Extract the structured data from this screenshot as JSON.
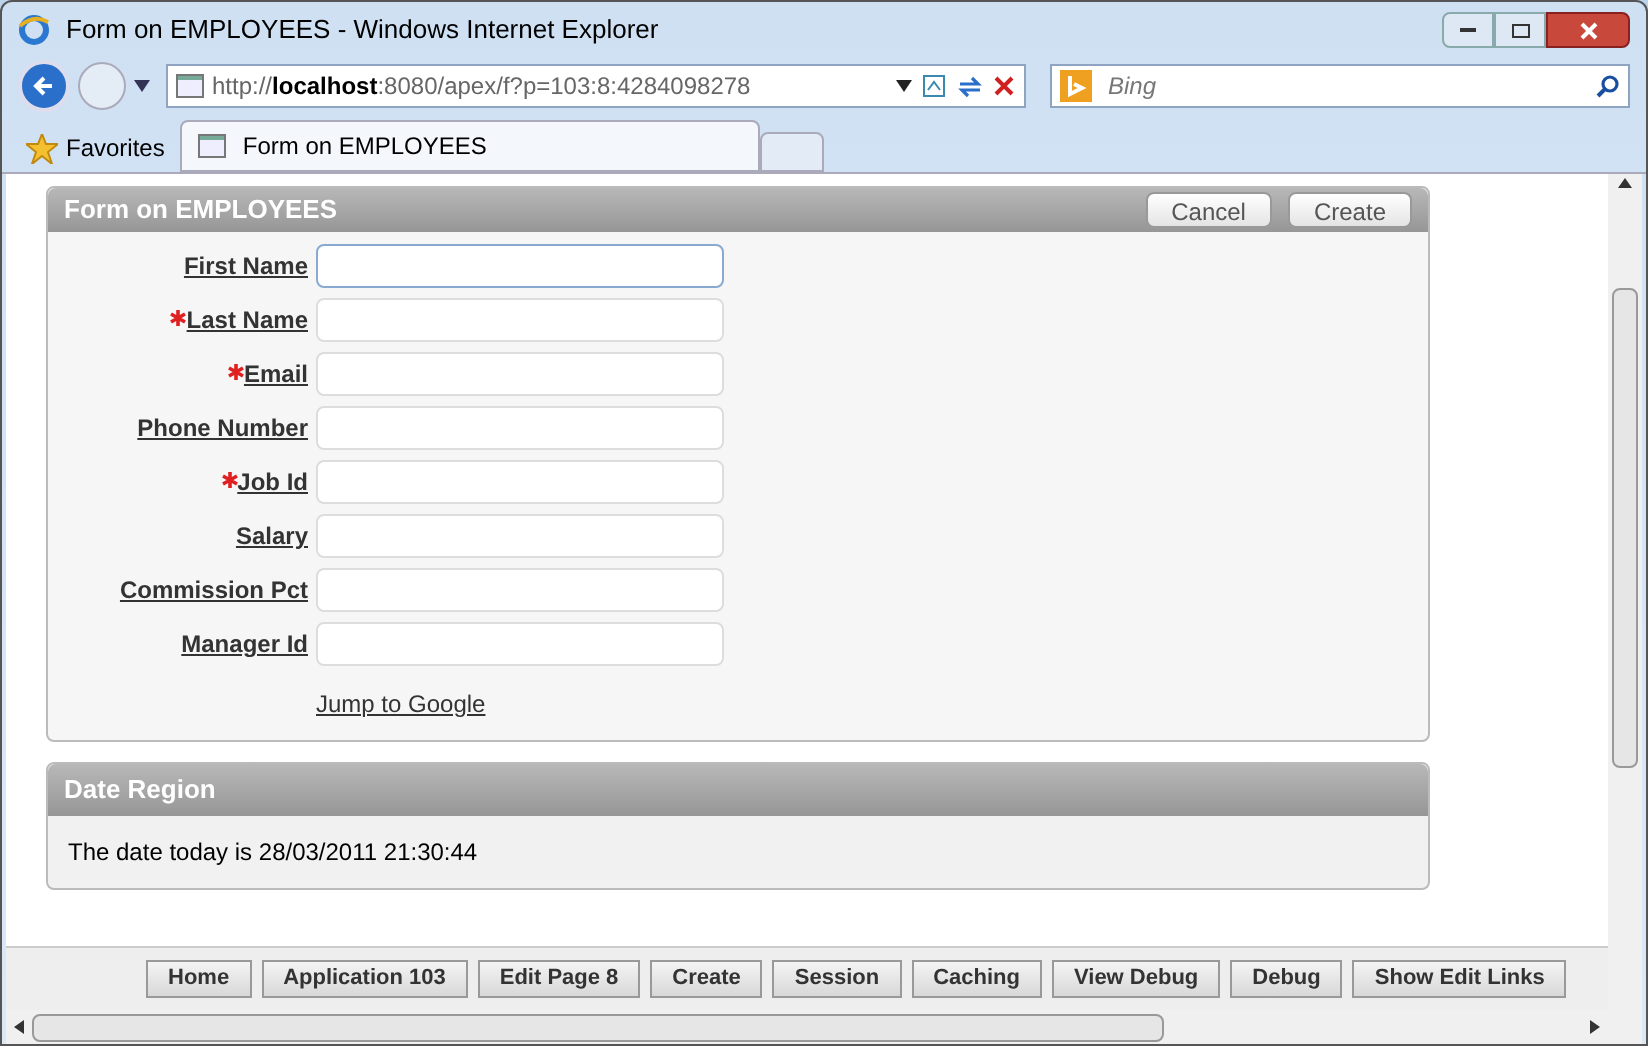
{
  "window": {
    "title": "Form on EMPLOYEES - Windows Internet Explorer"
  },
  "address_bar": {
    "url": "http://**localhost**:8080/apex/f?p=103:8:4284098278"
  },
  "search": {
    "placeholder": "Bing"
  },
  "favorites_bar": {
    "favorites": "Favorites",
    "tabs": [
      {
        "label": "Form on EMPLOYEES",
        "selected": true
      }
    ]
  },
  "form_region": {
    "title": "Form on EMPLOYEES",
    "buttons": [
      "Cancel",
      "Create"
    ],
    "fields": [
      {
        "label": "First Name",
        "required": false,
        "focused": true
      },
      {
        "label": "Last Name",
        "required": true,
        "focused": false
      },
      {
        "label": "Email",
        "required": true,
        "focused": false
      },
      {
        "label": "Phone Number",
        "required": false,
        "focused": false
      },
      {
        "label": "Job Id",
        "required": true,
        "focused": false
      },
      {
        "label": "Salary",
        "required": false,
        "focused": false
      },
      {
        "label": "Commission Pct",
        "required": false,
        "focused": false
      },
      {
        "label": "Manager Id",
        "required": false,
        "focused": false
      }
    ],
    "link": "Jump to Google"
  },
  "date_region": {
    "title": "Date Region",
    "text": "The date today is 28/03/2011 21:30:44"
  },
  "developer_toolbar": [
    "Home",
    "Application 103",
    "Edit Page 8",
    "Create",
    "Session",
    "Caching",
    "View Debug",
    "Debug",
    "Show Edit Links"
  ]
}
